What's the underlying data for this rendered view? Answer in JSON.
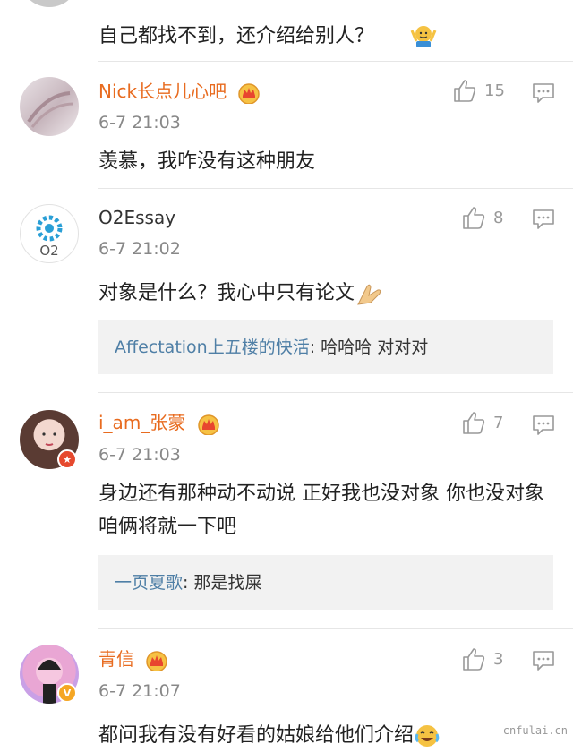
{
  "top_comment": {
    "text": "自己都找不到，还介绍给别人？"
  },
  "comments": [
    {
      "name": "Nick长点儿心吧",
      "time": "6-7 21:03",
      "text": "羡慕，我咋没有这种朋友",
      "likes": "15",
      "vip": true
    },
    {
      "name": "O2Essay",
      "time": "6-7 21:02",
      "text": "对象是什么？我心中只有论文",
      "likes": "8",
      "vip": false,
      "avatar_text": "O2",
      "reply": {
        "user": "Affectation上五楼的快活",
        "sep": ": ",
        "text": "哈哈哈 对对对"
      }
    },
    {
      "name": "i_am_张蒙",
      "time": "6-7 21:03",
      "text": "身边还有那种动不动说 正好我也没对象  你也没对象 咱俩将就一下吧",
      "likes": "7",
      "vip": true,
      "reply": {
        "user": "一页夏歌",
        "sep": ": ",
        "text": "那是找屎"
      }
    },
    {
      "name": "青信",
      "time": "6-7 21:07",
      "text": "都问我有没有好看的姑娘给他们介绍",
      "likes": "3",
      "vip": true
    }
  ],
  "watermark": "cnfulai.cn",
  "colors": {
    "vip_name": "#e86b1f",
    "reply_user": "#4f7fa6",
    "time": "#888888"
  }
}
